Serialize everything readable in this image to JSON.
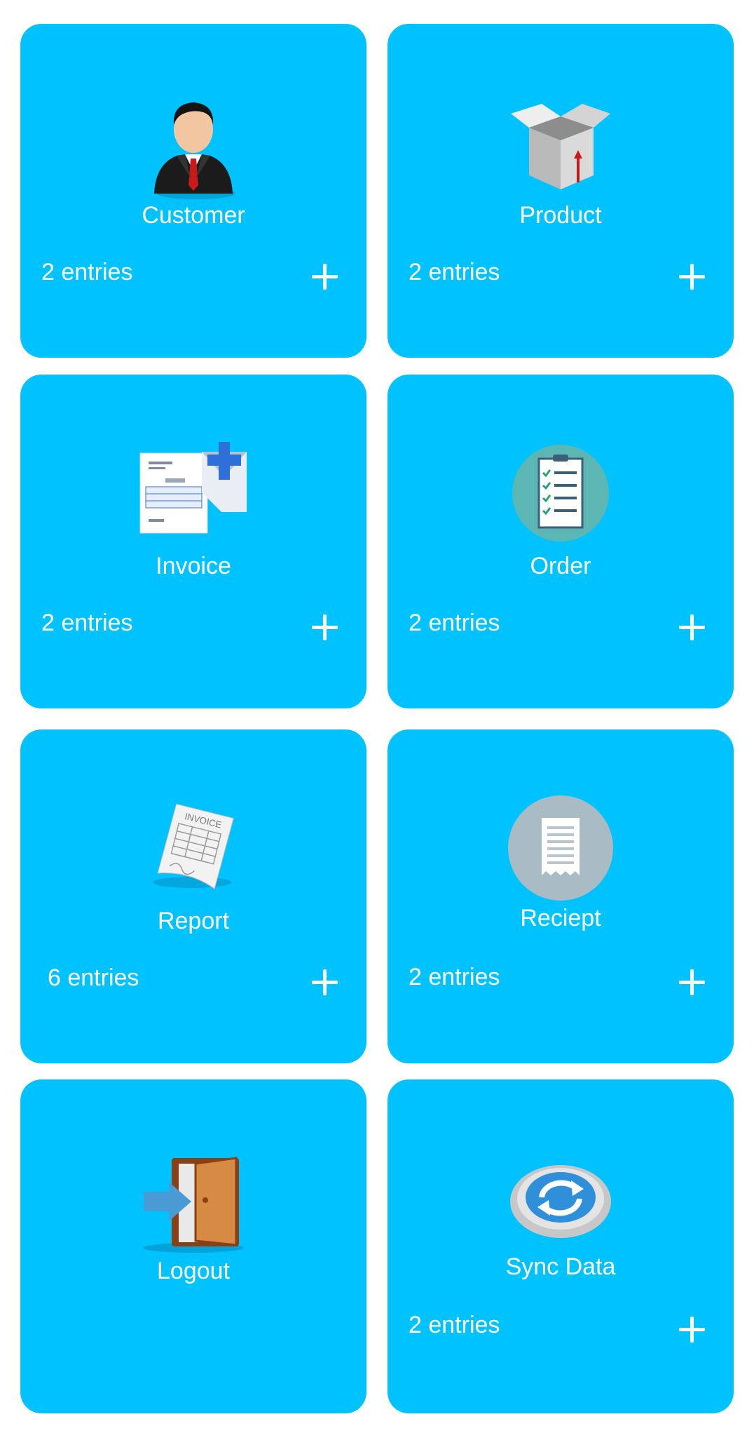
{
  "tiles": [
    {
      "title": "Customer",
      "count": "2 entries",
      "icon": "businessman-icon"
    },
    {
      "title": "Product",
      "count": "2 entries",
      "icon": "open-box-icon"
    },
    {
      "title": "Invoice",
      "count": "2 entries",
      "icon": "invoice-add-icon"
    },
    {
      "title": "Order",
      "count": "2 entries",
      "icon": "checklist-icon"
    },
    {
      "title": "Report",
      "count": "6 entries",
      "icon": "invoice-paper-icon"
    },
    {
      "title": "Reciept",
      "count": "2 entries",
      "icon": "receipt-icon"
    },
    {
      "title": "Logout",
      "icon": "door-exit-icon"
    },
    {
      "title": "Sync Data",
      "count": "2 entries",
      "icon": "sync-icon"
    }
  ],
  "invoice_paper_text": "INVOICE",
  "colors": {
    "tile": "#00c2ff",
    "text": "#ffffff"
  }
}
